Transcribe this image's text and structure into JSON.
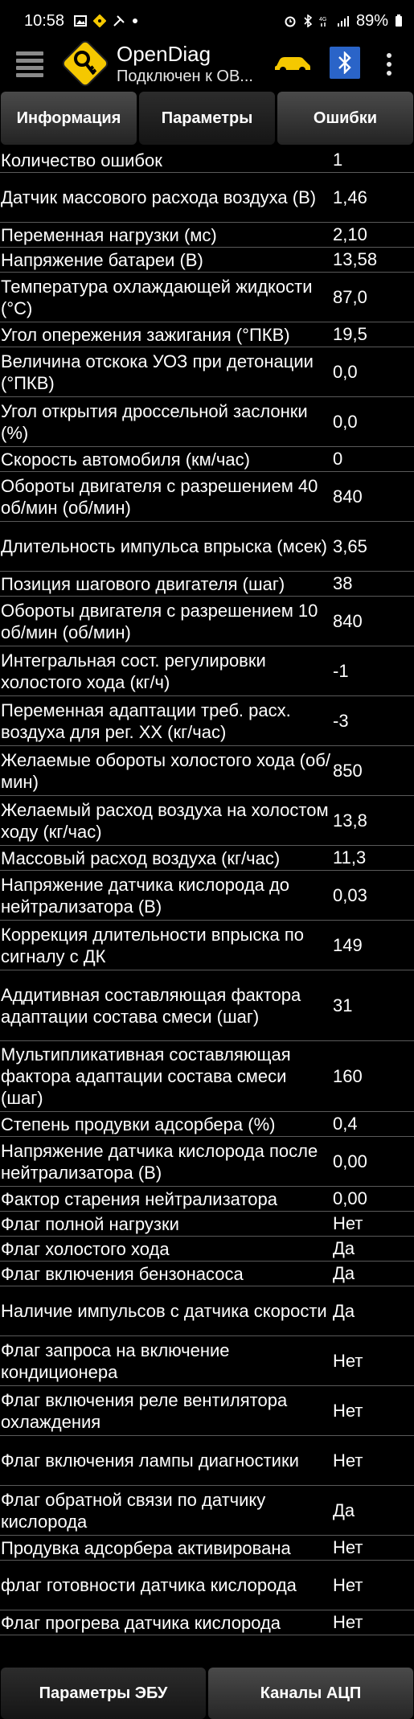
{
  "status_bar": {
    "time": "10:58",
    "battery": "89%"
  },
  "header": {
    "title": "OpenDiag",
    "subtitle": "Подключен к ОВ..."
  },
  "tabs": [
    {
      "label": "Информация",
      "active": false
    },
    {
      "label": "Параметры",
      "active": true
    },
    {
      "label": "Ошибки",
      "active": false
    }
  ],
  "rows": [
    {
      "name": "Количество ошибок",
      "value": "1"
    },
    {
      "name": "Датчик массового расхода воздуха (В)",
      "value": "1,46"
    },
    {
      "name": "Переменная нагрузки (мс)",
      "value": "2,10"
    },
    {
      "name": "Напряжение батареи (В)",
      "value": "13,58"
    },
    {
      "name": "Температура охлаждающей жидкости (°С)",
      "value": "87,0"
    },
    {
      "name": "Угол опережения зажигания (°ПКВ)",
      "value": "19,5"
    },
    {
      "name": "Величина отскока УОЗ при детонации (°ПКВ)",
      "value": "0,0"
    },
    {
      "name": "Угол открытия дроссельной заслонки (%)",
      "value": "0,0"
    },
    {
      "name": "Скорость автомобиля (км/час)",
      "value": "0"
    },
    {
      "name": "Обороты двигателя с разрешением 40 об/мин (об/мин)",
      "value": "840"
    },
    {
      "name": "Длительность импульса впрыска (мсек)",
      "value": "3,65"
    },
    {
      "name": "Позиция шагового двигателя (шаг)",
      "value": "38"
    },
    {
      "name": "Обороты двигателя с разрешением 10 об/мин (об/мин)",
      "value": "840"
    },
    {
      "name": "Интегральная сост. регулировки холостого хода (кг/ч)",
      "value": "-1"
    },
    {
      "name": "Переменная адаптации треб. расх. воздуха для рег. ХХ (кг/час)",
      "value": "-3"
    },
    {
      "name": "Желаемые обороты холостого хода (об/мин)",
      "value": "850"
    },
    {
      "name": "Желаемый расход воздуха на холостом ходу (кг/час)",
      "value": "13,8"
    },
    {
      "name": "Массовый расход воздуха (кг/час)",
      "value": "11,3"
    },
    {
      "name": "Напряжение датчика кислорода до нейтрализатора (В)",
      "value": "0,03"
    },
    {
      "name": "Коррекция длительности впрыска по сигналу с ДК",
      "value": "149"
    },
    {
      "name": "Аддитивная составляющая фактора адаптации состава смеси (шаг)",
      "value": "31"
    },
    {
      "name": "Мультипликативная составляющая фактора адаптации состава смеси (шаг)",
      "value": "160"
    },
    {
      "name": "Степень продувки адсорбера (%)",
      "value": "0,4"
    },
    {
      "name": "Напряжение датчика кислорода после нейтрализатора (В)",
      "value": "0,00"
    },
    {
      "name": "Фактор старения нейтрализатора",
      "value": "0,00"
    },
    {
      "name": "Флаг полной нагрузки",
      "value": "Нет"
    },
    {
      "name": "Флаг холостого хода",
      "value": "Да"
    },
    {
      "name": "Флаг включения бензонасоса",
      "value": "Да"
    },
    {
      "name": "Наличие импульсов с датчика скорости",
      "value": "Да"
    },
    {
      "name": "Флаг запроса на включение кондиционера",
      "value": "Нет"
    },
    {
      "name": "Флаг включения реле вентилятора охлаждения",
      "value": "Нет"
    },
    {
      "name": "Флаг включения лампы диагностики",
      "value": "Нет"
    },
    {
      "name": "Флаг обратной связи по датчику кислорода",
      "value": "Да"
    },
    {
      "name": "Продувка адсорбера активирована",
      "value": "Нет"
    },
    {
      "name": "флаг готовности датчика кислорода",
      "value": "Нет"
    },
    {
      "name": "Флаг прогрева датчика кислорода",
      "value": "Нет"
    }
  ],
  "bottom_buttons": [
    {
      "label": "Параметры ЭБУ",
      "active": true
    },
    {
      "label": "Каналы АЦП",
      "active": false
    }
  ],
  "colors": {
    "background": "#000000",
    "bluetooth": "#2a64c8",
    "logo_yellow": "#f5c800",
    "car_yellow": "#f5c800"
  }
}
